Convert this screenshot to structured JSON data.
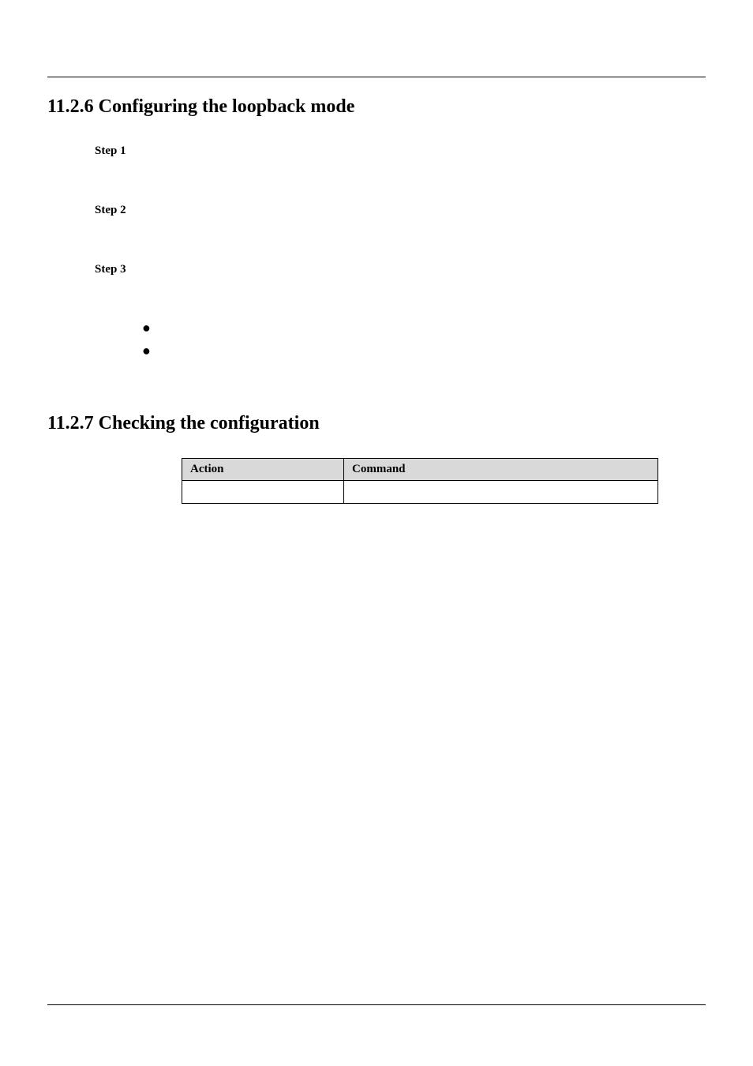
{
  "header": {
    "left": "",
    "right": ""
  },
  "section1": {
    "title": "11.2.6 Configuring the loopback mode",
    "steps": [
      {
        "label": "Step 1",
        "content": "",
        "paras": []
      },
      {
        "label": "Step 2",
        "content": "",
        "paras": []
      },
      {
        "label": "Step 3",
        "content": "",
        "paras": []
      }
    ],
    "bullets": [
      "",
      ""
    ]
  },
  "section2": {
    "title": "11.2.7 Checking the configuration",
    "table": {
      "headers": [
        "Action",
        "Command"
      ],
      "rows": [
        [
          "",
          ""
        ]
      ]
    }
  },
  "footer": {
    "left": "",
    "right": ""
  }
}
